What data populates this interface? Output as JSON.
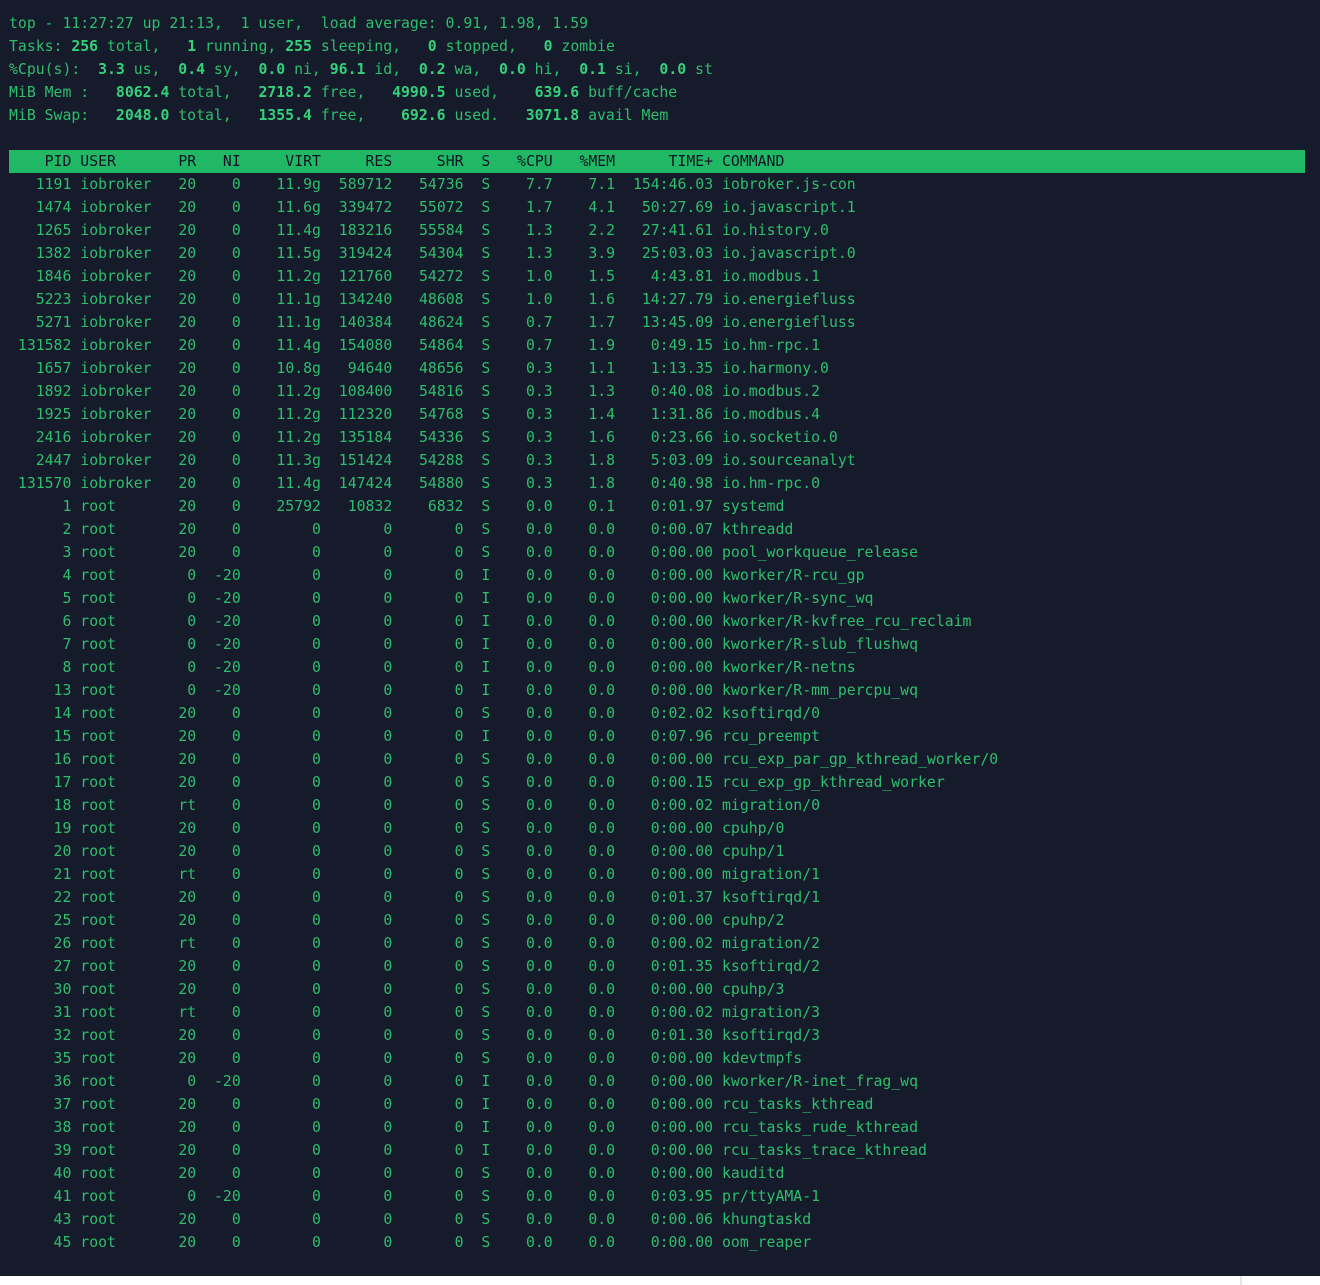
{
  "summary": {
    "line1": [
      {
        "t": "top - 11:27:27 up 21:13,  1 user,  load average: 0.91, 1.98, 1.59",
        "b": false
      }
    ],
    "line2": [
      {
        "t": "Tasks: ",
        "b": false
      },
      {
        "t": "256",
        "b": true
      },
      {
        "t": " total,   ",
        "b": false
      },
      {
        "t": "1",
        "b": true
      },
      {
        "t": " running, ",
        "b": false
      },
      {
        "t": "255",
        "b": true
      },
      {
        "t": " sleeping,   ",
        "b": false
      },
      {
        "t": "0",
        "b": true
      },
      {
        "t": " stopped,   ",
        "b": false
      },
      {
        "t": "0",
        "b": true
      },
      {
        "t": " zombie",
        "b": false
      }
    ],
    "line3": [
      {
        "t": "%Cpu(s):  ",
        "b": false
      },
      {
        "t": "3.3",
        "b": true
      },
      {
        "t": " us,  ",
        "b": false
      },
      {
        "t": "0.4",
        "b": true
      },
      {
        "t": " sy,  ",
        "b": false
      },
      {
        "t": "0.0",
        "b": true
      },
      {
        "t": " ni, ",
        "b": false
      },
      {
        "t": "96.1",
        "b": true
      },
      {
        "t": " id,  ",
        "b": false
      },
      {
        "t": "0.2",
        "b": true
      },
      {
        "t": " wa,  ",
        "b": false
      },
      {
        "t": "0.0",
        "b": true
      },
      {
        "t": " hi,  ",
        "b": false
      },
      {
        "t": "0.1",
        "b": true
      },
      {
        "t": " si,  ",
        "b": false
      },
      {
        "t": "0.0",
        "b": true
      },
      {
        "t": " st",
        "b": false
      }
    ],
    "line4": [
      {
        "t": "MiB Mem :   ",
        "b": false
      },
      {
        "t": "8062.4",
        "b": true
      },
      {
        "t": " total,   ",
        "b": false
      },
      {
        "t": "2718.2",
        "b": true
      },
      {
        "t": " free,   ",
        "b": false
      },
      {
        "t": "4990.5",
        "b": true
      },
      {
        "t": " used,    ",
        "b": false
      },
      {
        "t": "639.6",
        "b": true
      },
      {
        "t": " buff/cache",
        "b": false
      }
    ],
    "line5": [
      {
        "t": "MiB Swap:   ",
        "b": false
      },
      {
        "t": "2048.0",
        "b": true
      },
      {
        "t": " total,   ",
        "b": false
      },
      {
        "t": "1355.4",
        "b": true
      },
      {
        "t": " free,    ",
        "b": false
      },
      {
        "t": "692.6",
        "b": true
      },
      {
        "t": " used.   ",
        "b": false
      },
      {
        "t": "3071.8",
        "b": true
      },
      {
        "t": " avail Mem",
        "b": false
      }
    ]
  },
  "columns": [
    "PID",
    "USER",
    "PR",
    "NI",
    "VIRT",
    "RES",
    "SHR",
    "S",
    "%CPU",
    "%MEM",
    "TIME+",
    "COMMAND"
  ],
  "processes": [
    [
      "1191",
      "iobroker",
      "20",
      "0",
      "11.9g",
      "589712",
      "54736",
      "S",
      "7.7",
      "7.1",
      "154:46.03",
      "iobroker.js-con"
    ],
    [
      "1474",
      "iobroker",
      "20",
      "0",
      "11.6g",
      "339472",
      "55072",
      "S",
      "1.7",
      "4.1",
      "50:27.69",
      "io.javascript.1"
    ],
    [
      "1265",
      "iobroker",
      "20",
      "0",
      "11.4g",
      "183216",
      "55584",
      "S",
      "1.3",
      "2.2",
      "27:41.61",
      "io.history.0"
    ],
    [
      "1382",
      "iobroker",
      "20",
      "0",
      "11.5g",
      "319424",
      "54304",
      "S",
      "1.3",
      "3.9",
      "25:03.03",
      "io.javascript.0"
    ],
    [
      "1846",
      "iobroker",
      "20",
      "0",
      "11.2g",
      "121760",
      "54272",
      "S",
      "1.0",
      "1.5",
      "4:43.81",
      "io.modbus.1"
    ],
    [
      "5223",
      "iobroker",
      "20",
      "0",
      "11.1g",
      "134240",
      "48608",
      "S",
      "1.0",
      "1.6",
      "14:27.79",
      "io.energiefluss"
    ],
    [
      "5271",
      "iobroker",
      "20",
      "0",
      "11.1g",
      "140384",
      "48624",
      "S",
      "0.7",
      "1.7",
      "13:45.09",
      "io.energiefluss"
    ],
    [
      "131582",
      "iobroker",
      "20",
      "0",
      "11.4g",
      "154080",
      "54864",
      "S",
      "0.7",
      "1.9",
      "0:49.15",
      "io.hm-rpc.1"
    ],
    [
      "1657",
      "iobroker",
      "20",
      "0",
      "10.8g",
      "94640",
      "48656",
      "S",
      "0.3",
      "1.1",
      "1:13.35",
      "io.harmony.0"
    ],
    [
      "1892",
      "iobroker",
      "20",
      "0",
      "11.2g",
      "108400",
      "54816",
      "S",
      "0.3",
      "1.3",
      "0:40.08",
      "io.modbus.2"
    ],
    [
      "1925",
      "iobroker",
      "20",
      "0",
      "11.2g",
      "112320",
      "54768",
      "S",
      "0.3",
      "1.4",
      "1:31.86",
      "io.modbus.4"
    ],
    [
      "2416",
      "iobroker",
      "20",
      "0",
      "11.2g",
      "135184",
      "54336",
      "S",
      "0.3",
      "1.6",
      "0:23.66",
      "io.socketio.0"
    ],
    [
      "2447",
      "iobroker",
      "20",
      "0",
      "11.3g",
      "151424",
      "54288",
      "S",
      "0.3",
      "1.8",
      "5:03.09",
      "io.sourceanalyt"
    ],
    [
      "131570",
      "iobroker",
      "20",
      "0",
      "11.4g",
      "147424",
      "54880",
      "S",
      "0.3",
      "1.8",
      "0:40.98",
      "io.hm-rpc.0"
    ],
    [
      "1",
      "root",
      "20",
      "0",
      "25792",
      "10832",
      "6832",
      "S",
      "0.0",
      "0.1",
      "0:01.97",
      "systemd"
    ],
    [
      "2",
      "root",
      "20",
      "0",
      "0",
      "0",
      "0",
      "S",
      "0.0",
      "0.0",
      "0:00.07",
      "kthreadd"
    ],
    [
      "3",
      "root",
      "20",
      "0",
      "0",
      "0",
      "0",
      "S",
      "0.0",
      "0.0",
      "0:00.00",
      "pool_workqueue_release"
    ],
    [
      "4",
      "root",
      "0",
      "-20",
      "0",
      "0",
      "0",
      "I",
      "0.0",
      "0.0",
      "0:00.00",
      "kworker/R-rcu_gp"
    ],
    [
      "5",
      "root",
      "0",
      "-20",
      "0",
      "0",
      "0",
      "I",
      "0.0",
      "0.0",
      "0:00.00",
      "kworker/R-sync_wq"
    ],
    [
      "6",
      "root",
      "0",
      "-20",
      "0",
      "0",
      "0",
      "I",
      "0.0",
      "0.0",
      "0:00.00",
      "kworker/R-kvfree_rcu_reclaim"
    ],
    [
      "7",
      "root",
      "0",
      "-20",
      "0",
      "0",
      "0",
      "I",
      "0.0",
      "0.0",
      "0:00.00",
      "kworker/R-slub_flushwq"
    ],
    [
      "8",
      "root",
      "0",
      "-20",
      "0",
      "0",
      "0",
      "I",
      "0.0",
      "0.0",
      "0:00.00",
      "kworker/R-netns"
    ],
    [
      "13",
      "root",
      "0",
      "-20",
      "0",
      "0",
      "0",
      "I",
      "0.0",
      "0.0",
      "0:00.00",
      "kworker/R-mm_percpu_wq"
    ],
    [
      "14",
      "root",
      "20",
      "0",
      "0",
      "0",
      "0",
      "S",
      "0.0",
      "0.0",
      "0:02.02",
      "ksoftirqd/0"
    ],
    [
      "15",
      "root",
      "20",
      "0",
      "0",
      "0",
      "0",
      "I",
      "0.0",
      "0.0",
      "0:07.96",
      "rcu_preempt"
    ],
    [
      "16",
      "root",
      "20",
      "0",
      "0",
      "0",
      "0",
      "S",
      "0.0",
      "0.0",
      "0:00.00",
      "rcu_exp_par_gp_kthread_worker/0"
    ],
    [
      "17",
      "root",
      "20",
      "0",
      "0",
      "0",
      "0",
      "S",
      "0.0",
      "0.0",
      "0:00.15",
      "rcu_exp_gp_kthread_worker"
    ],
    [
      "18",
      "root",
      "rt",
      "0",
      "0",
      "0",
      "0",
      "S",
      "0.0",
      "0.0",
      "0:00.02",
      "migration/0"
    ],
    [
      "19",
      "root",
      "20",
      "0",
      "0",
      "0",
      "0",
      "S",
      "0.0",
      "0.0",
      "0:00.00",
      "cpuhp/0"
    ],
    [
      "20",
      "root",
      "20",
      "0",
      "0",
      "0",
      "0",
      "S",
      "0.0",
      "0.0",
      "0:00.00",
      "cpuhp/1"
    ],
    [
      "21",
      "root",
      "rt",
      "0",
      "0",
      "0",
      "0",
      "S",
      "0.0",
      "0.0",
      "0:00.00",
      "migration/1"
    ],
    [
      "22",
      "root",
      "20",
      "0",
      "0",
      "0",
      "0",
      "S",
      "0.0",
      "0.0",
      "0:01.37",
      "ksoftirqd/1"
    ],
    [
      "25",
      "root",
      "20",
      "0",
      "0",
      "0",
      "0",
      "S",
      "0.0",
      "0.0",
      "0:00.00",
      "cpuhp/2"
    ],
    [
      "26",
      "root",
      "rt",
      "0",
      "0",
      "0",
      "0",
      "S",
      "0.0",
      "0.0",
      "0:00.02",
      "migration/2"
    ],
    [
      "27",
      "root",
      "20",
      "0",
      "0",
      "0",
      "0",
      "S",
      "0.0",
      "0.0",
      "0:01.35",
      "ksoftirqd/2"
    ],
    [
      "30",
      "root",
      "20",
      "0",
      "0",
      "0",
      "0",
      "S",
      "0.0",
      "0.0",
      "0:00.00",
      "cpuhp/3"
    ],
    [
      "31",
      "root",
      "rt",
      "0",
      "0",
      "0",
      "0",
      "S",
      "0.0",
      "0.0",
      "0:00.02",
      "migration/3"
    ],
    [
      "32",
      "root",
      "20",
      "0",
      "0",
      "0",
      "0",
      "S",
      "0.0",
      "0.0",
      "0:01.30",
      "ksoftirqd/3"
    ],
    [
      "35",
      "root",
      "20",
      "0",
      "0",
      "0",
      "0",
      "S",
      "0.0",
      "0.0",
      "0:00.00",
      "kdevtmpfs"
    ],
    [
      "36",
      "root",
      "0",
      "-20",
      "0",
      "0",
      "0",
      "I",
      "0.0",
      "0.0",
      "0:00.00",
      "kworker/R-inet_frag_wq"
    ],
    [
      "37",
      "root",
      "20",
      "0",
      "0",
      "0",
      "0",
      "I",
      "0.0",
      "0.0",
      "0:00.00",
      "rcu_tasks_kthread"
    ],
    [
      "38",
      "root",
      "20",
      "0",
      "0",
      "0",
      "0",
      "I",
      "0.0",
      "0.0",
      "0:00.00",
      "rcu_tasks_rude_kthread"
    ],
    [
      "39",
      "root",
      "20",
      "0",
      "0",
      "0",
      "0",
      "I",
      "0.0",
      "0.0",
      "0:00.00",
      "rcu_tasks_trace_kthread"
    ],
    [
      "40",
      "root",
      "20",
      "0",
      "0",
      "0",
      "0",
      "S",
      "0.0",
      "0.0",
      "0:00.00",
      "kauditd"
    ],
    [
      "41",
      "root",
      "0",
      "-20",
      "0",
      "0",
      "0",
      "S",
      "0.0",
      "0.0",
      "0:03.95",
      "pr/ttyAMA-1"
    ],
    [
      "43",
      "root",
      "20",
      "0",
      "0",
      "0",
      "0",
      "S",
      "0.0",
      "0.0",
      "0:00.06",
      "khungtaskd"
    ],
    [
      "45",
      "root",
      "20",
      "0",
      "0",
      "0",
      "0",
      "S",
      "0.0",
      "0.0",
      "0:00.00",
      "oom_reaper"
    ]
  ],
  "colors": {
    "background": "#161b2c",
    "text": "#2ebd6c",
    "header_bar": "#21b865",
    "header_text": "#0f1424"
  }
}
